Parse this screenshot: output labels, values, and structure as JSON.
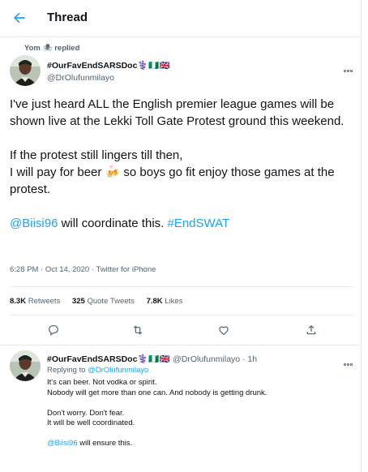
{
  "header": {
    "title": "Thread"
  },
  "social_context": {
    "user": "Yom",
    "emoji": "🕷",
    "text": "replied"
  },
  "tweet": {
    "name": "#OurFavEndSARSDoc",
    "name_emoji": "⚕️🇳🇬🇬🇧",
    "handle": "@DrOlufunmilayo",
    "para1": "I've just heard ALL the English premier league games will be shown live at the Lekki Toll Gate Protest ground this weekend.",
    "para2_line1": "If the protest still lingers till then,",
    "para2_line2_before": "I will pay for beer ",
    "beer_emoji": "🍻",
    "para2_line2_after": " so boys go fit enjoy those games at the protest.",
    "mention": "@Biisi96",
    "para3_middle": " will coordinate this. ",
    "hashtag": "#EndSWAT",
    "timestamp": "6:28 PM · Oct 14, 2020 · Twitter for iPhone",
    "stats": {
      "retweets_count": "8.3K",
      "retweets_label": "Retweets",
      "quotes_count": "325",
      "quotes_label": "Quote Tweets",
      "likes_count": "7.8K",
      "likes_label": "Likes"
    }
  },
  "reply": {
    "name": "#OurFavEndSARSDoc",
    "name_emoji": "⚕️🇳🇬🇬🇧",
    "handle": "@DrOlufunmilayo",
    "time": "· 1h",
    "replying_label": "Replying to ",
    "replying_handle": "@DrOlufunmilayo",
    "line1": "It's can beer. Not vodka or spirit.",
    "line2": "Nobody will get more than one can. And nobody is getting drunk.",
    "line3": "Don't worry. Don't fear.",
    "line4": "It will be well coordinated.",
    "mention": "@Biisi96",
    "line5_after": " will ensure this."
  },
  "icons": {
    "back": "back-arrow-icon",
    "reply": "reply-icon",
    "retweet": "retweet-icon",
    "like": "heart-icon",
    "share": "share-icon",
    "more": "more-icon"
  },
  "colors": {
    "accent": "#1da1f2",
    "text": "#0f1419",
    "secondary": "#536471",
    "divider": "#e6ecf0"
  }
}
